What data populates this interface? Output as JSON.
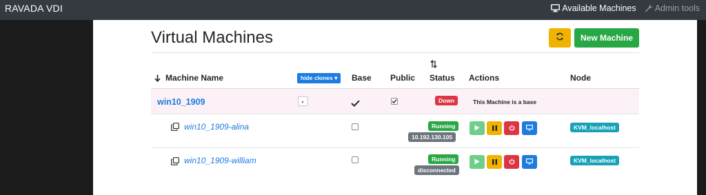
{
  "navbar": {
    "brand": "RAVADA VDI",
    "links": [
      {
        "label": "Available Machines",
        "icon": "monitor-icon"
      },
      {
        "label": "Admin tools",
        "icon": "wrench-icon"
      }
    ]
  },
  "page": {
    "title": "Virtual Machines",
    "new_machine_label": "New Machine",
    "refresh_icon": "refresh-icon"
  },
  "table": {
    "headers": {
      "machine_name": "Machine Name",
      "hide_clones": "hide clones",
      "base": "Base",
      "public": "Public",
      "status": "Status",
      "actions": "Actions",
      "node": "Node"
    },
    "base_row": {
      "name": "win10_1909",
      "is_base": true,
      "is_public": true,
      "status": "Down",
      "note": "This Machine is a base"
    },
    "clones": [
      {
        "name": "win10_1909-alina",
        "is_public": false,
        "status": "Running",
        "address": "10.192.130.105",
        "node": "KVM_localhost"
      },
      {
        "name": "win10_1909-william",
        "is_public": false,
        "status": "Running",
        "address": "disconnected",
        "node": "KVM_localhost"
      }
    ]
  },
  "colors": {
    "primary": "#1e7be0",
    "success": "#28a745",
    "warning": "#f0b400",
    "danger": "#dc3545",
    "info": "#17a2b8",
    "secondary": "#6c757d",
    "navbar": "#343a40"
  }
}
